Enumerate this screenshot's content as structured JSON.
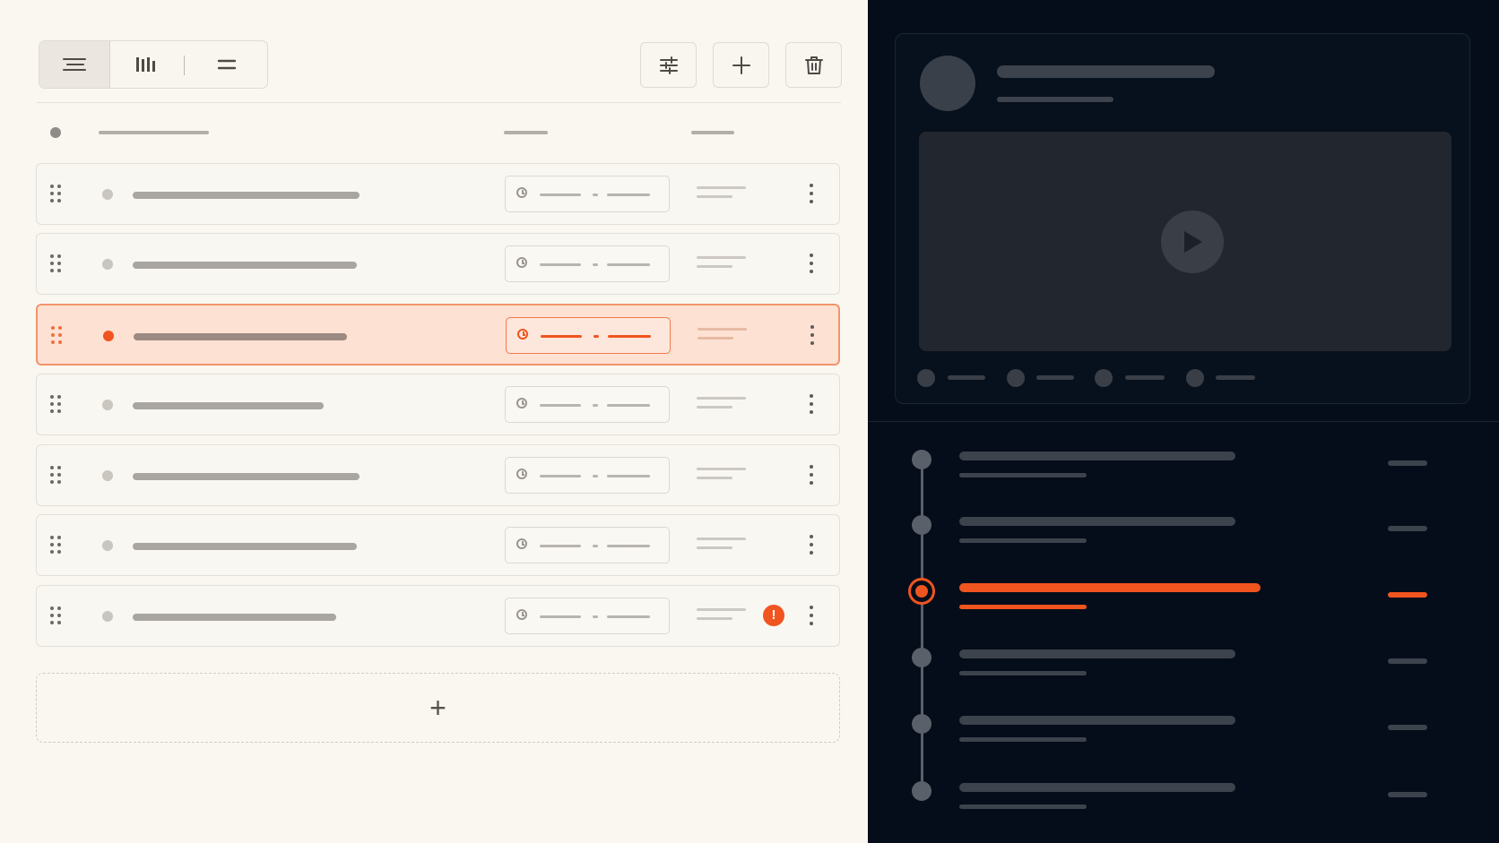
{
  "toolbar": {
    "view_modes": [
      {
        "name": "list-view-icon",
        "active": true
      },
      {
        "name": "board-view-icon",
        "active": false
      },
      {
        "name": "compact-view-icon",
        "active": false
      }
    ],
    "actions": [
      "filter-sliders-icon",
      "plus-icon",
      "trash-icon"
    ]
  },
  "rows": [
    {
      "active": false,
      "warning": false
    },
    {
      "active": false,
      "warning": false
    },
    {
      "active": true,
      "warning": false
    },
    {
      "active": false,
      "warning": false
    },
    {
      "active": false,
      "warning": false
    },
    {
      "active": false,
      "warning": false
    },
    {
      "active": false,
      "warning": true
    }
  ],
  "warning_icon": {
    "glyph": "!"
  },
  "add_row": {
    "glyph": "+"
  },
  "colors": {
    "accent": "#f0541f",
    "panel_dark": "#050d1a",
    "panel_light": "#faf7f1"
  },
  "timeline": {
    "nodes": 6,
    "active_index": 2
  }
}
